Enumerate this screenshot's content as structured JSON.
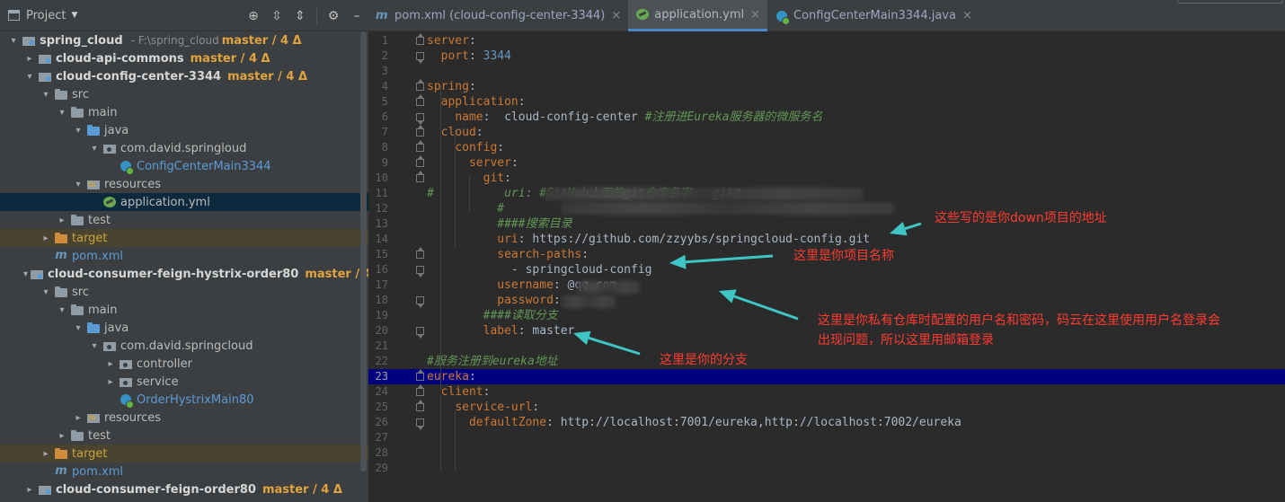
{
  "project_panel": {
    "title": "Project",
    "tree": [
      {
        "label": "spring_cloud",
        "path": "F:\\spring_cloud",
        "git": "master / 4 Δ",
        "arrow": "▾",
        "icon": "module"
      },
      {
        "label": "cloud-api-commons",
        "git": "master / 4 Δ",
        "arrow": "▸",
        "icon": "module"
      },
      {
        "label": "cloud-config-center-3344",
        "git": "master / 4 Δ",
        "arrow": "▾",
        "icon": "module"
      },
      {
        "label": "src",
        "arrow": "▾",
        "icon": "folder"
      },
      {
        "label": "main",
        "arrow": "▾",
        "icon": "folder"
      },
      {
        "label": "java",
        "arrow": "▾",
        "icon": "folder-blue"
      },
      {
        "label": "com.david.springloud",
        "arrow": "▾",
        "icon": "package"
      },
      {
        "label": "ConfigCenterMain3344",
        "arrow": "",
        "icon": "class-spring"
      },
      {
        "label": "resources",
        "arrow": "▾",
        "icon": "resources"
      },
      {
        "label": "application.yml",
        "arrow": "",
        "icon": "yml",
        "selected": true
      },
      {
        "label": "test",
        "arrow": "▸",
        "icon": "folder"
      },
      {
        "label": "target",
        "arrow": "▸",
        "icon": "folder-orange",
        "excluded": true
      },
      {
        "label": "pom.xml",
        "arrow": "",
        "icon": "maven"
      },
      {
        "label": "cloud-consumer-feign-hystrix-order80",
        "git": "master / 4 Δ",
        "arrow": "▾",
        "icon": "module"
      },
      {
        "label": "src",
        "arrow": "▾",
        "icon": "folder"
      },
      {
        "label": "main",
        "arrow": "▾",
        "icon": "folder"
      },
      {
        "label": "java",
        "arrow": "▾",
        "icon": "folder-blue"
      },
      {
        "label": "com.david.springcloud",
        "arrow": "▾",
        "icon": "package"
      },
      {
        "label": "controller",
        "arrow": "▸",
        "icon": "package"
      },
      {
        "label": "service",
        "arrow": "▸",
        "icon": "package"
      },
      {
        "label": "OrderHystrixMain80",
        "arrow": "",
        "icon": "class-spring"
      },
      {
        "label": "resources",
        "arrow": "▸",
        "icon": "resources"
      },
      {
        "label": "test",
        "arrow": "▸",
        "icon": "folder"
      },
      {
        "label": "target",
        "arrow": "▸",
        "icon": "folder-orange",
        "excluded": true
      },
      {
        "label": "pom.xml",
        "arrow": "",
        "icon": "maven"
      },
      {
        "label": "cloud-consumer-feign-order80",
        "git": "master / 4 Δ",
        "arrow": "▸",
        "icon": "module"
      }
    ]
  },
  "editor": {
    "tabs": [
      {
        "label": "pom.xml (cloud-config-center-3344)",
        "icon": "maven",
        "active": false
      },
      {
        "label": "application.yml",
        "icon": "yml",
        "active": true
      },
      {
        "label": "ConfigCenterMain3344.java",
        "icon": "class-spring",
        "active": false
      }
    ],
    "current_line": 23,
    "lines": [
      "server:",
      "  port: 3344",
      "",
      "spring:",
      "  application:",
      "    name:  cloud-config-center #注册进Eureka服务器的微服务名",
      "  cloud:",
      "    config:",
      "      server:",
      "        git:",
      "#          uri: #GitHub上面的git仓库名字   git@",
      "          #",
      "          ####搜索目录",
      "          uri: https://github.com/zzyybs/springcloud-config.git",
      "          search-paths:",
      "            - springcloud-config",
      "          username: @qq.com",
      "          password:",
      "        ####读取分支",
      "        label: master",
      "",
      "#服务注册到eureka地址",
      "eureka:",
      "  client:",
      "    service-url:",
      "      defaultZone: http://localhost:7001/eureka,http://localhost:7002/eureka",
      "",
      "",
      ""
    ]
  },
  "annotations": {
    "down_address": "这些写的是你down项目的地址",
    "project_name": "这里是你项目名称",
    "credentials_line1": "这里是你私有仓库时配置的用户名和密码，码云在这里使用用户名登录会",
    "credentials_line2": "出现问题，所以这里用邮箱登录",
    "branch": "这里是你的分支",
    "color": "#ff3b30",
    "arrow_color": "#3ec6c6"
  }
}
